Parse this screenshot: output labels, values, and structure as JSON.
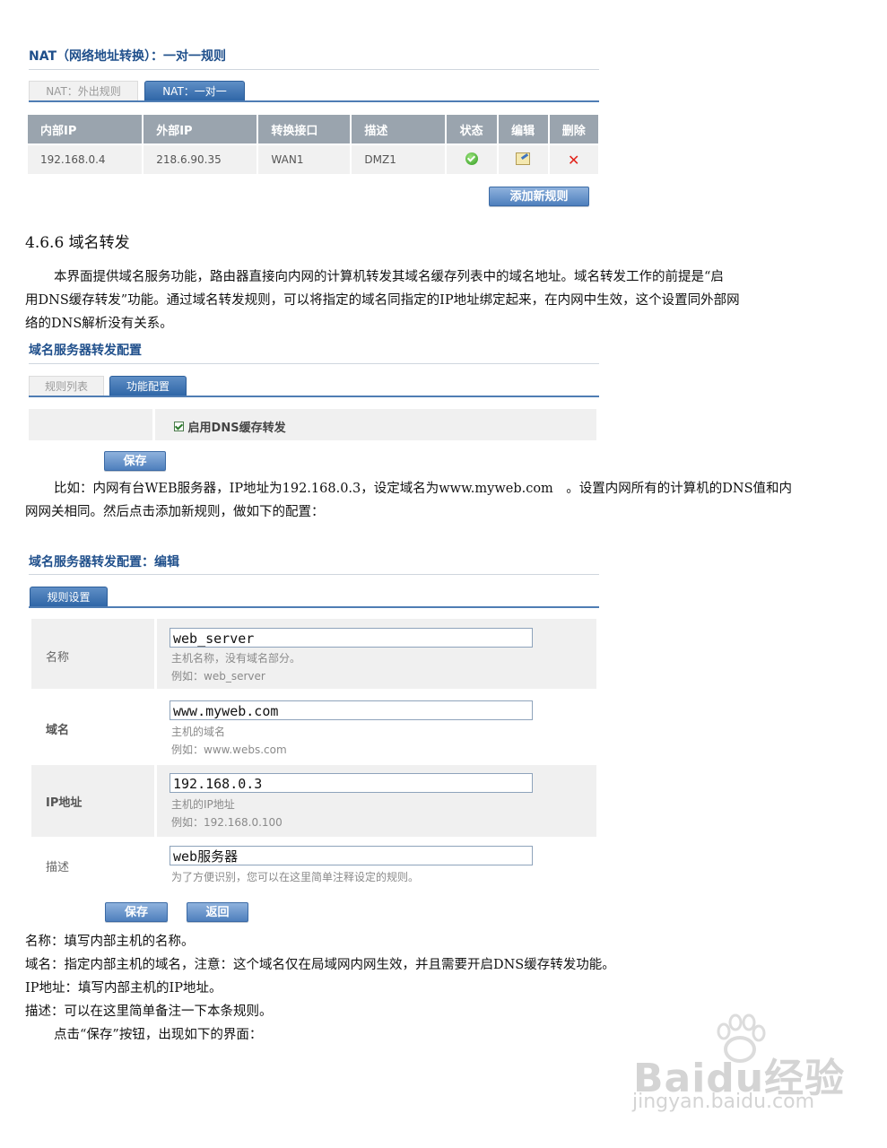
{
  "nat": {
    "title": "NAT（网络地址转换）：一对一规则",
    "tabs": [
      "NAT：外出规则",
      "NAT：一对一"
    ],
    "headers": [
      "内部IP",
      "外部IP",
      "转换接口",
      "描述",
      "状态",
      "编辑",
      "删除"
    ],
    "row": [
      "192.168.0.4",
      "218.6.90.35",
      "WAN1",
      "DMZ1"
    ],
    "add_button": "添加新规则"
  },
  "section": {
    "heading": "4.6.6 域名转发",
    "para1_line1": "本界面提供域名服务功能，路由器直接向内网的计算机转发其域名缓存列表中的域名地址。域名转发工作的前提是“启",
    "para1_line2": "用DNS缓存转发”功能。通过域名转发规则，可以将指定的域名同指定的IP地址绑定起来，在内网中生效，这个设置同外部网",
    "para1_line3": "络的DNS解析没有关系。"
  },
  "dns_config": {
    "title": "域名服务器转发配置",
    "tabs": [
      "规则列表",
      "功能配置"
    ],
    "checkbox_label": "启用DNS缓存转发",
    "save_button": "保存"
  },
  "example": {
    "line1": "比如：内网有台WEB服务器，IP地址为192.168.0.3，设定域名为www.myweb.com　。设置内网所有的计算机的DNS值和内",
    "line2": "网网关相同。然后点击添加新规则，做如下的配置："
  },
  "edit_form": {
    "title": "域名服务器转发配置：编辑",
    "tab": "规则设置",
    "rows": [
      {
        "label": "名称",
        "value": "web_server",
        "hint1": "主机名称，没有域名部分。",
        "hint2": "例如：web_server"
      },
      {
        "label": "域名",
        "value": "www.myweb.com",
        "hint1": "主机的域名",
        "hint2": "例如：www.webs.com"
      },
      {
        "label": "IP地址",
        "value": "192.168.0.3",
        "hint1": "主机的IP地址",
        "hint2": "例如：192.168.0.100"
      },
      {
        "label": "描述",
        "value": "web服务器",
        "hint1": "为了方便识别，您可以在这里简单注释设定的规则。",
        "hint2": ""
      }
    ],
    "save_button": "保存",
    "back_button": "返回"
  },
  "notes": {
    "name": "名称：填写内部主机的名称。",
    "domain": "域名：指定内部主机的域名，注意：这个域名仅在局域网内网生效，并且需要开启DNS缓存转发功能。",
    "ip": "IP地址：填写内部主机的IP地址。",
    "desc": "描述：可以在这里简单备注一下本条规则。",
    "save": "点击“保存”按钮，出现如下的界面："
  },
  "watermark": {
    "logo": "Baidu经验",
    "url": "jingyan.baidu.com"
  }
}
